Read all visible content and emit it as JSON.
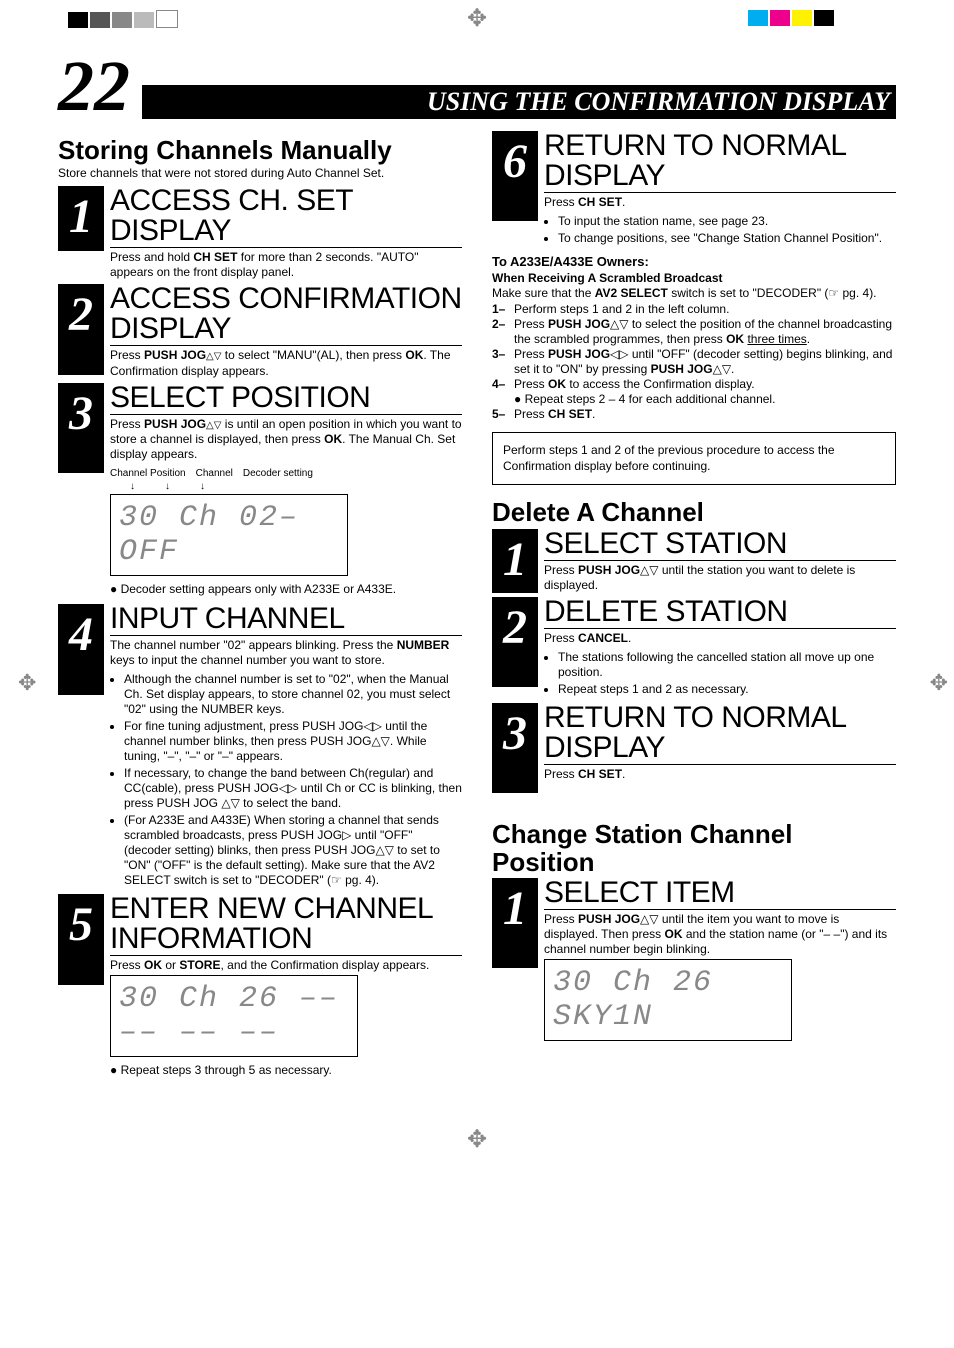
{
  "page_number": "22",
  "section_bar": "USING THE CONFIRMATION DISPLAY",
  "left": {
    "main_heading": "Storing Channels Manually",
    "intro": "Store channels that were not stored during Auto Channel Set.",
    "s1": {
      "num": "1",
      "title": "ACCESS CH. SET DISPLAY",
      "text_a": "Press and hold ",
      "text_b": "CH SET",
      "text_c": " for more than 2 seconds. \"AUTO\" appears on the front display panel."
    },
    "s2": {
      "num": "2",
      "title": "ACCESS CONFIRMATION DISPLAY",
      "text_a": "Press ",
      "text_b": "PUSH JOG",
      "text_c": " to select \"MANU\"(AL), then press ",
      "text_d": "OK",
      "text_e": ". The Confirmation display appears."
    },
    "s3": {
      "num": "3",
      "title": "SELECT POSITION",
      "text_a": "Press ",
      "text_b": "PUSH JOG",
      "text_c": " is until an open position in which you want to store a channel is displayed, then press ",
      "text_d": "OK",
      "text_e": ". The Manual Ch. Set display appears.",
      "labels": {
        "cp": "Channel Position",
        "ch": "Channel",
        "ds": "Decoder setting"
      },
      "display": "30 Ch 02– OFF",
      "note": "Decoder setting appears only with A233E or A433E."
    },
    "s4": {
      "num": "4",
      "title": "INPUT CHANNEL",
      "intro_a": "The channel number \"02\" appears blinking. Press the ",
      "intro_b": "NUMBER",
      "intro_c": " keys to input the channel number you want to store.",
      "b1": "Although the channel number is set to \"02\", when the Manual Ch. Set display appears, to store channel 02, you must select \"02\" using the NUMBER keys.",
      "b2": "For fine tuning adjustment, press PUSH JOG◁▷ until the channel number blinks, then press PUSH JOG△▽. While tuning, \"–\", \"–\" or \"–\" appears.",
      "b3": "If necessary, to change the band between Ch(regular) and CC(cable), press PUSH JOG◁▷ until Ch or CC is blinking, then press PUSH JOG △▽ to select the band.",
      "b4": "(For A233E and A433E) When storing a channel that sends scrambled broadcasts, press PUSH JOG▷ until \"OFF\" (decoder setting) blinks, then press PUSH JOG△▽ to set to \"ON\" (\"OFF\" is the default setting). Make sure that the AV2 SELECT switch is set to \"DECODER\" (☞ pg. 4)."
    },
    "s5": {
      "num": "5",
      "title": "ENTER NEW CHANNEL INFORMATION",
      "text_a": "Press ",
      "text_b": "OK",
      "text_c": " or ",
      "text_d": "STORE",
      "text_e": ", and the Confirmation display appears.",
      "display": "30 Ch 26 –– –– –– ––",
      "note": "Repeat steps 3 through 5 as necessary."
    }
  },
  "right": {
    "s6": {
      "num": "6",
      "title": "RETURN TO NORMAL DISPLAY",
      "text_a": "Press ",
      "text_b": "CH SET",
      "text_c": ".",
      "b1": "To input the station name, see page 23.",
      "b2": "To change positions, see \"Change Station Channel Position\"."
    },
    "owners_heading": "To A233E/A433E Owners:",
    "owners_sub": "When Receiving A Scrambled Broadcast",
    "owners_intro_a": "Make sure that the ",
    "owners_intro_b": "AV2 SELECT",
    "owners_intro_c": " switch is set to \"DECODER\" (☞ pg. 4).",
    "n1": {
      "n": "1–",
      "t": "Perform steps 1 and 2 in the left column."
    },
    "n2": {
      "n": "2–",
      "t_a": "Press ",
      "t_b": "PUSH JOG",
      "t_c": "△▽ to select the position of the channel broadcasting the scrambled programmes, then press ",
      "t_d": "OK",
      "t_e": " three times.",
      "ul": "three times"
    },
    "n3": {
      "n": "3–",
      "t_a": "Press ",
      "t_b": "PUSH JOG",
      "t_c": "◁▷ until \"OFF\" (decoder setting) begins blinking, and set it to \"ON\" by pressing ",
      "t_d": "PUSH JOG",
      "t_e": "△▽."
    },
    "n4": {
      "n": "4–",
      "t_a": "Press ",
      "t_b": "OK",
      "t_c": " to access the Confirmation display.",
      "sub": "Repeat steps 2 – 4 for each additional channel."
    },
    "n5": {
      "n": "5–",
      "t_a": "Press ",
      "t_b": "CH SET",
      "t_c": "."
    },
    "info_box": "Perform steps 1 and 2 of the previous procedure to access the Confirmation display before continuing.",
    "del_heading": "Delete A Channel",
    "d1": {
      "num": "1",
      "title": "SELECT STATION",
      "text_a": "Press ",
      "text_b": "PUSH JOG",
      "text_c": "△▽ until the station you want to delete is displayed."
    },
    "d2": {
      "num": "2",
      "title": "DELETE STATION",
      "text_a": "Press ",
      "text_b": "CANCEL",
      "text_c": ".",
      "b1": "The stations following the cancelled station all move up one position.",
      "b2": "Repeat steps 1 and 2 as necessary."
    },
    "d3": {
      "num": "3",
      "title": "RETURN TO NORMAL DISPLAY",
      "text_a": "Press ",
      "text_b": "CH SET",
      "text_c": "."
    },
    "change_heading": "Change Station Channel Position",
    "c1": {
      "num": "1",
      "title": "SELECT ITEM",
      "text_a": "Press ",
      "text_b": "PUSH JOG",
      "text_c": "△▽ until the item you want to move is displayed. Then press ",
      "text_d": "OK",
      "text_e": " and the station name (or \"– –\") and its channel number begin blinking.",
      "display": "30 Ch 26 SKY1N"
    }
  }
}
